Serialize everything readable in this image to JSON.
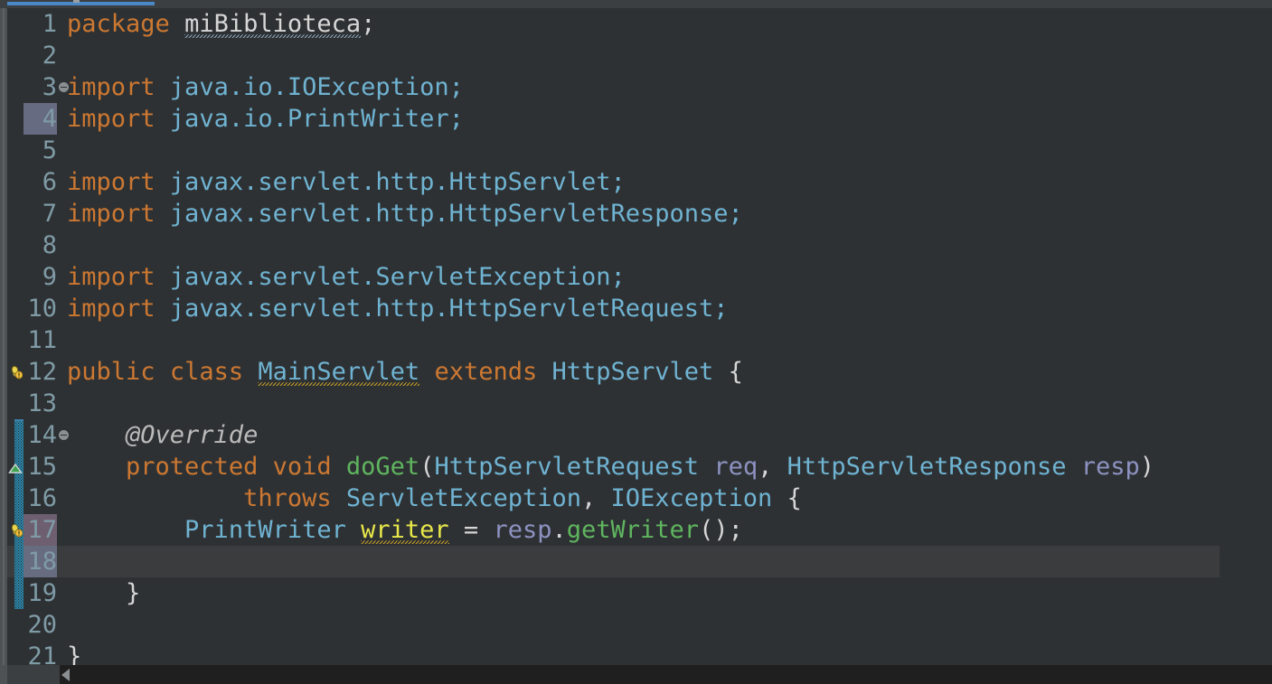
{
  "window": {
    "app": "IntelliJ IDEA Java Editor",
    "theme": "Darcula",
    "colors": {
      "editor_background": "#2e3133",
      "gutter_background": "#2e3133",
      "caret_line": "#3a3c3e",
      "keyword": "#cc7832",
      "type": "#6fb3d2",
      "method": "#5fb55f",
      "parameter": "#8d92c2",
      "field": "#e8e84a",
      "plain_text": "#d6d6d6",
      "annotation": "#bbbbbb",
      "line_number": "#7f9ba6",
      "tab_accent": "#4a88c7",
      "scope_hatch": "#2a85a8",
      "warning_squiggle": "#c9a227",
      "info_squiggle": "#8fa8c0"
    }
  },
  "tab": {
    "accent_color": "#4a88c7"
  },
  "editor": {
    "language": "Java",
    "caret_line_number": 18,
    "selected_gutter_lines": [
      4,
      17,
      18
    ],
    "fold_marker_lines": [
      3,
      14
    ],
    "scope_bar_range": [
      14,
      19
    ],
    "lines": [
      {
        "n": 1,
        "tokens": [
          {
            "t": "package",
            "c": "kw"
          },
          {
            "t": " ",
            "c": "pln"
          },
          {
            "t": "miBiblioteca",
            "c": "pln",
            "u": "grey"
          },
          {
            "t": ";",
            "c": "pln"
          }
        ]
      },
      {
        "n": 2,
        "tokens": []
      },
      {
        "n": 3,
        "tokens": [
          {
            "t": "import",
            "c": "kw"
          },
          {
            "t": " java.io.IOException;",
            "c": "typ"
          }
        ]
      },
      {
        "n": 4,
        "tokens": [
          {
            "t": "import",
            "c": "kw"
          },
          {
            "t": " java.io.PrintWriter;",
            "c": "typ"
          }
        ]
      },
      {
        "n": 5,
        "tokens": []
      },
      {
        "n": 6,
        "tokens": [
          {
            "t": "import",
            "c": "kw"
          },
          {
            "t": " javax.servlet.http.HttpServlet;",
            "c": "typ"
          }
        ]
      },
      {
        "n": 7,
        "tokens": [
          {
            "t": "import",
            "c": "kw"
          },
          {
            "t": " javax.servlet.http.HttpServletResponse;",
            "c": "typ"
          }
        ]
      },
      {
        "n": 8,
        "tokens": []
      },
      {
        "n": 9,
        "tokens": [
          {
            "t": "import",
            "c": "kw"
          },
          {
            "t": " javax.servlet.ServletException;",
            "c": "typ"
          }
        ]
      },
      {
        "n": 10,
        "tokens": [
          {
            "t": "import",
            "c": "kw"
          },
          {
            "t": " javax.servlet.http.HttpServletRequest;",
            "c": "typ"
          }
        ]
      },
      {
        "n": 11,
        "tokens": []
      },
      {
        "n": 12,
        "tokens": [
          {
            "t": "public",
            "c": "kw"
          },
          {
            "t": " ",
            "c": "pln"
          },
          {
            "t": "class",
            "c": "kw"
          },
          {
            "t": " ",
            "c": "pln"
          },
          {
            "t": "MainServlet",
            "c": "typ",
            "u": "yellow"
          },
          {
            "t": " ",
            "c": "pln"
          },
          {
            "t": "extends",
            "c": "kw"
          },
          {
            "t": " ",
            "c": "pln"
          },
          {
            "t": "HttpServlet",
            "c": "typ"
          },
          {
            "t": " {",
            "c": "pln"
          }
        ]
      },
      {
        "n": 13,
        "tokens": []
      },
      {
        "n": 14,
        "tokens": [
          {
            "t": "    @Override",
            "c": "ann"
          }
        ]
      },
      {
        "n": 15,
        "tokens": [
          {
            "t": "    ",
            "c": "pln"
          },
          {
            "t": "protected",
            "c": "kw"
          },
          {
            "t": " ",
            "c": "pln"
          },
          {
            "t": "void",
            "c": "kw"
          },
          {
            "t": " ",
            "c": "pln"
          },
          {
            "t": "doGet",
            "c": "mth"
          },
          {
            "t": "(",
            "c": "pln"
          },
          {
            "t": "HttpServletRequest",
            "c": "typ"
          },
          {
            "t": " ",
            "c": "pln"
          },
          {
            "t": "req",
            "c": "par"
          },
          {
            "t": ", ",
            "c": "pln"
          },
          {
            "t": "HttpServletResponse",
            "c": "typ"
          },
          {
            "t": " ",
            "c": "pln"
          },
          {
            "t": "resp",
            "c": "par"
          },
          {
            "t": ")",
            "c": "pln"
          }
        ]
      },
      {
        "n": 16,
        "tokens": [
          {
            "t": "            ",
            "c": "pln"
          },
          {
            "t": "throws",
            "c": "kw"
          },
          {
            "t": " ",
            "c": "pln"
          },
          {
            "t": "ServletException",
            "c": "typ"
          },
          {
            "t": ", ",
            "c": "pln"
          },
          {
            "t": "IOException",
            "c": "typ"
          },
          {
            "t": " {",
            "c": "pln"
          }
        ]
      },
      {
        "n": 17,
        "tokens": [
          {
            "t": "        ",
            "c": "pln"
          },
          {
            "t": "PrintWriter",
            "c": "typ"
          },
          {
            "t": " ",
            "c": "pln"
          },
          {
            "t": "writer",
            "c": "fld",
            "u": "yellow"
          },
          {
            "t": " = ",
            "c": "pln"
          },
          {
            "t": "resp",
            "c": "par"
          },
          {
            "t": ".",
            "c": "pln"
          },
          {
            "t": "getWriter",
            "c": "mth"
          },
          {
            "t": "();",
            "c": "pln"
          }
        ]
      },
      {
        "n": 18,
        "tokens": []
      },
      {
        "n": 19,
        "tokens": [
          {
            "t": "    }",
            "c": "pln"
          }
        ]
      },
      {
        "n": 20,
        "tokens": []
      },
      {
        "n": 21,
        "tokens": [
          {
            "t": "}",
            "c": "pln"
          }
        ]
      }
    ],
    "gutter_icons": [
      {
        "line": 12,
        "icon": "lightbulb-warning-icon"
      },
      {
        "line": 15,
        "icon": "override-method-icon"
      },
      {
        "line": 17,
        "icon": "lightbulb-warning-icon"
      }
    ]
  },
  "scrollbar": {
    "orientation": "horizontal",
    "arrow_icon": "scroll-left-arrow-icon"
  }
}
